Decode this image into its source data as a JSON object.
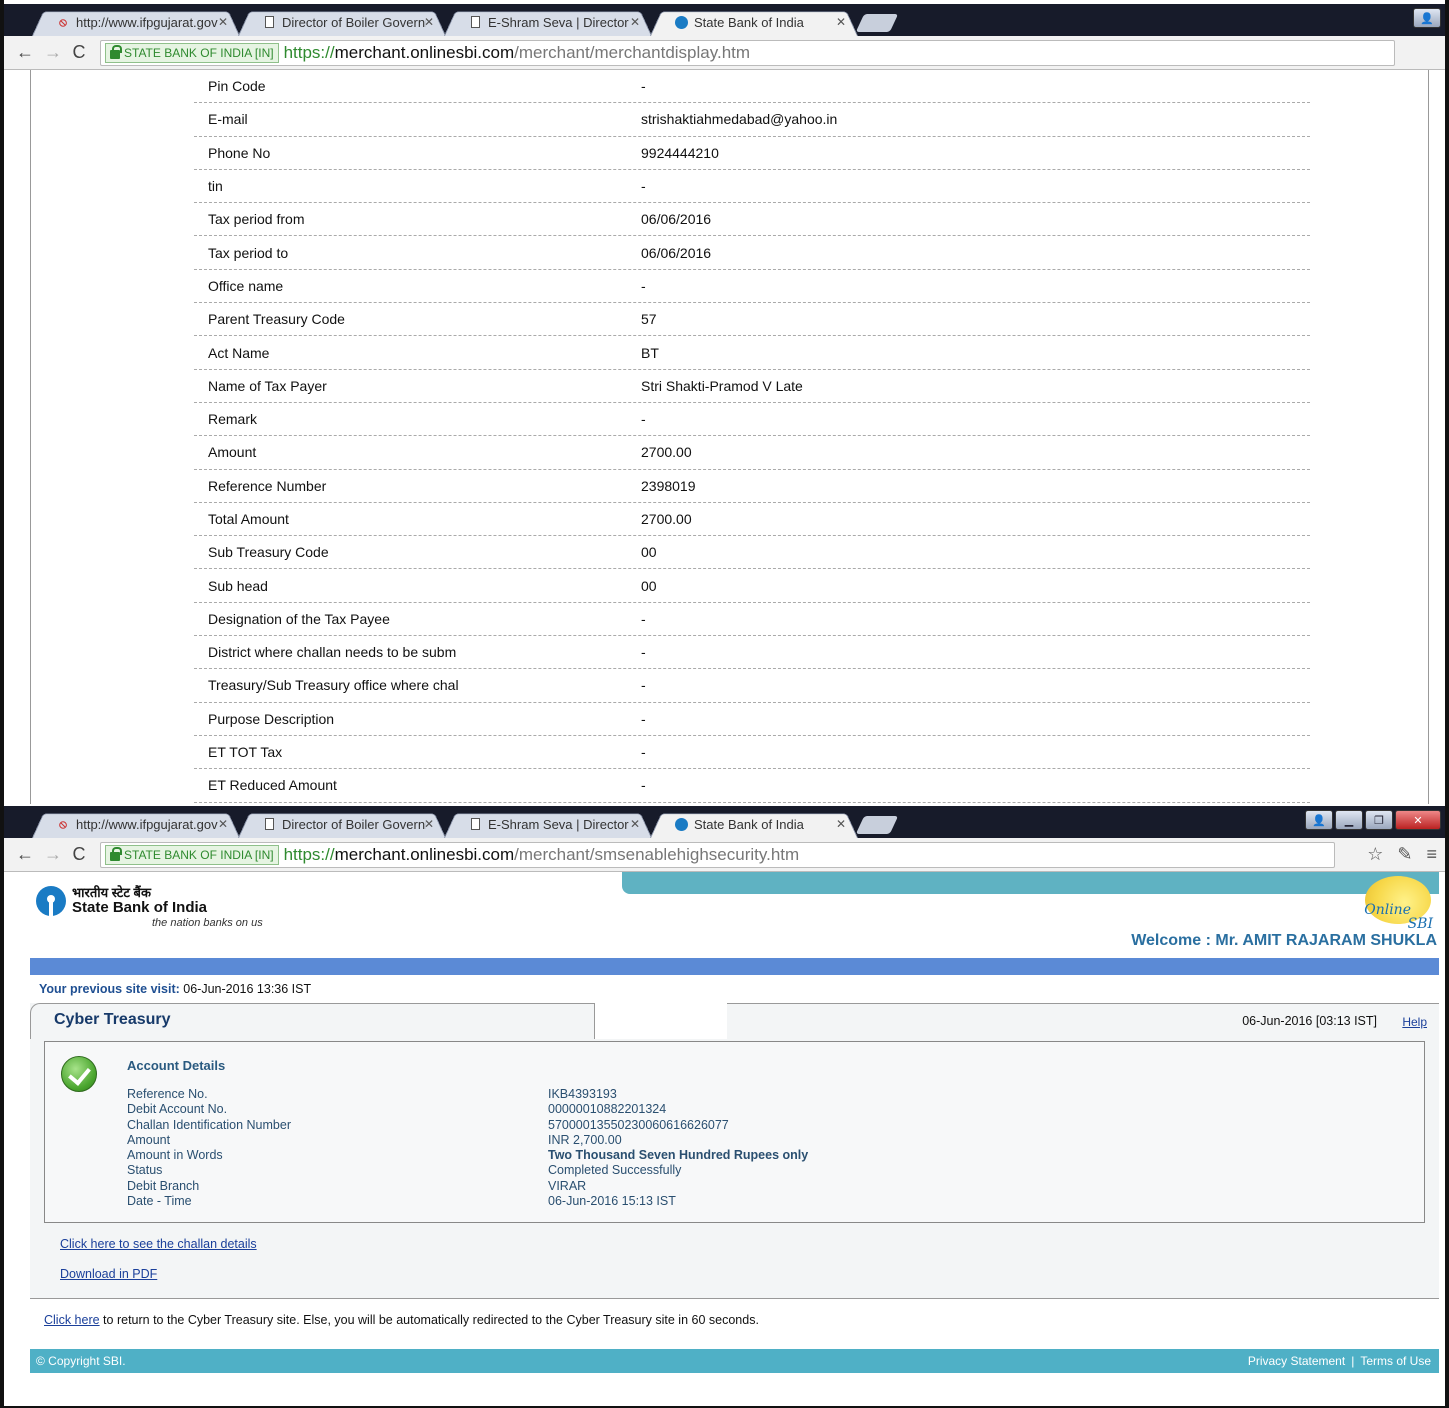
{
  "browser_top": {
    "tabs": [
      {
        "title": "http://www.ifpgujarat.gov",
        "icon": "pdf-icon",
        "active": false
      },
      {
        "title": "Director of Boiler Governm",
        "icon": "page-icon",
        "active": false
      },
      {
        "title": "E-Shram Seva | Director of",
        "icon": "page-icon",
        "active": false
      },
      {
        "title": "State Bank of India",
        "icon": "sbi-icon",
        "active": true
      }
    ],
    "ev_label": "STATE BANK OF INDIA [IN]",
    "url_scheme": "https://",
    "url_host": "merchant.onlinesbi.com",
    "url_path": "/merchant/merchantdisplay.htm"
  },
  "merchant_details": [
    {
      "label": "Pin Code",
      "value": "-"
    },
    {
      "label": "E-mail",
      "value": "strishaktiahmedabad@yahoo.in"
    },
    {
      "label": "Phone No",
      "value": "9924444210"
    },
    {
      "label": "tin",
      "value": "-"
    },
    {
      "label": "Tax period from",
      "value": "06/06/2016"
    },
    {
      "label": "Tax period to",
      "value": "06/06/2016"
    },
    {
      "label": "Office name",
      "value": "-"
    },
    {
      "label": "Parent Treasury Code",
      "value": "57"
    },
    {
      "label": "Act Name",
      "value": "BT"
    },
    {
      "label": "Name of Tax Payer",
      "value": "Stri Shakti-Pramod V Late"
    },
    {
      "label": "Remark",
      "value": "-"
    },
    {
      "label": "Amount",
      "value": "2700.00"
    },
    {
      "label": "Reference Number",
      "value": "2398019"
    },
    {
      "label": "Total Amount",
      "value": "2700.00"
    },
    {
      "label": "Sub Treasury Code",
      "value": "00"
    },
    {
      "label": "Sub head",
      "value": "00"
    },
    {
      "label": "Designation of the Tax Payee",
      "value": "-"
    },
    {
      "label": "District where challan needs to be subm",
      "value": "-"
    },
    {
      "label": "Treasury/Sub Treasury office where chal",
      "value": "-"
    },
    {
      "label": "Purpose Description",
      "value": "-"
    },
    {
      "label": "ET TOT Tax",
      "value": "-"
    },
    {
      "label": "ET Reduced Amount",
      "value": "-"
    }
  ],
  "browser_bottom": {
    "tabs": [
      {
        "title": "http://www.ifpgujarat.gov",
        "icon": "pdf-icon",
        "active": false
      },
      {
        "title": "Director of Boiler Governm",
        "icon": "page-icon",
        "active": false
      },
      {
        "title": "E-Shram Seva | Director of",
        "icon": "page-icon",
        "active": false
      },
      {
        "title": "State Bank of India",
        "icon": "sbi-icon",
        "active": true
      }
    ],
    "ev_label": "STATE BANK OF INDIA [IN]",
    "url_scheme": "https://",
    "url_host": "merchant.onlinesbi.com",
    "url_path": "/merchant/smsenablehighsecurity.htm"
  },
  "sbi": {
    "logo_hindi": "भारतीय स्टेट बैंक",
    "logo_name": "State Bank of India",
    "tagline": "the nation banks on us",
    "online_word": "Online",
    "online_sbi": "SBI",
    "welcome": "Welcome : Mr. AMIT RAJARAM SHUKLA",
    "prev_visit_label": "Your previous site visit:",
    "prev_visit_value": "06-Jun-2016 13:36 IST",
    "panel_title": "Cyber Treasury",
    "panel_date": "06-Jun-2016 [03:13 IST]",
    "help": "Help",
    "account_title": "Account Details",
    "account_rows": [
      {
        "k": "Reference No.",
        "v": "IKB4393193"
      },
      {
        "k": "Debit Account No.",
        "v": "00000010882201324"
      },
      {
        "k": "Challan Identification Number",
        "v": "57000013550230060616626077"
      },
      {
        "k": "Amount",
        "v": "INR  2,700.00"
      },
      {
        "k": "Amount in Words",
        "v": "Two Thousand Seven Hundred Rupees only"
      },
      {
        "k": "Status",
        "v": "Completed Successfully"
      },
      {
        "k": "Debit Branch",
        "v": "VIRAR"
      },
      {
        "k": "Date - Time",
        "v": "06-Jun-2016 15:13 IST"
      }
    ],
    "challan_link": "Click here to see the challan details",
    "pdf_link": "Download in PDF",
    "redirect_link": "Click here",
    "redirect_text": " to return to the Cyber Treasury site. Else, you will be automatically redirected to the Cyber Treasury site in 60 seconds.",
    "copyright": "© Copyright SBI.",
    "privacy": "Privacy Statement",
    "separator": "|",
    "terms": "Terms of Use"
  }
}
